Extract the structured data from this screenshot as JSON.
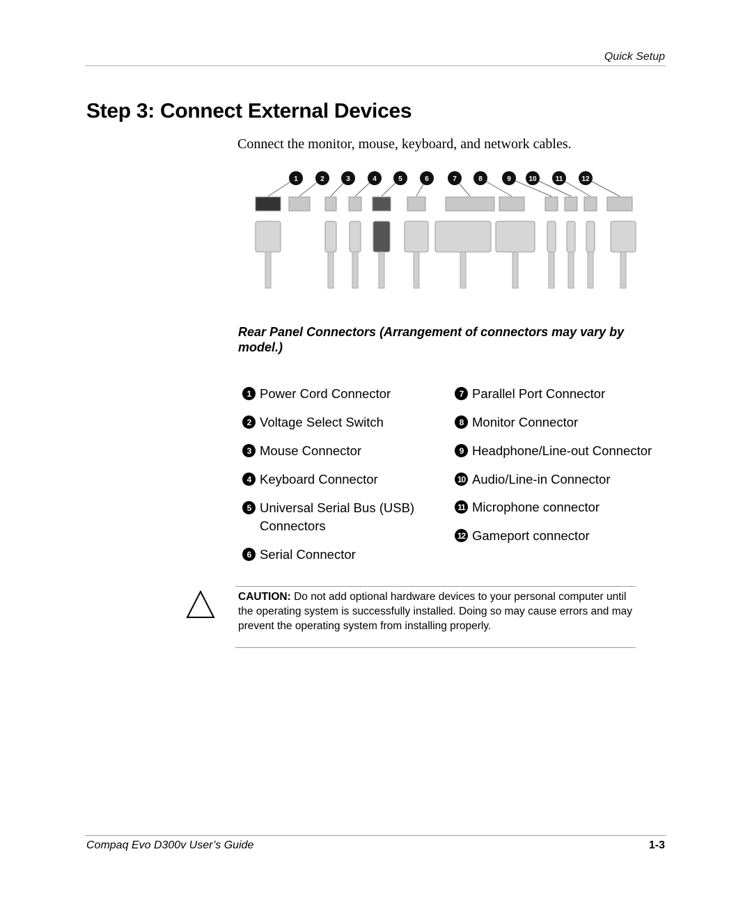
{
  "header": {
    "running_head": "Quick Setup"
  },
  "title": "Step 3: Connect External Devices",
  "intro": "Connect the monitor, mouse, keyboard, and network cables.",
  "figure": {
    "callout_numbers": [
      "1",
      "2",
      "3",
      "4",
      "5",
      "6",
      "7",
      "8",
      "9",
      "10",
      "11",
      "12"
    ]
  },
  "caption": "Rear Panel Connectors (Arrangement of connectors may vary by model.)",
  "legend": {
    "left": [
      {
        "num": "1",
        "label": "Power Cord Connector"
      },
      {
        "num": "2",
        "label": "Voltage Select Switch"
      },
      {
        "num": "3",
        "label": "Mouse Connector"
      },
      {
        "num": "4",
        "label": "Keyboard Connector"
      },
      {
        "num": "5",
        "label": "Universal Serial Bus (USB) Connectors"
      },
      {
        "num": "6",
        "label": "Serial Connector"
      }
    ],
    "right": [
      {
        "num": "7",
        "label": "Parallel Port Connector"
      },
      {
        "num": "8",
        "label": "Monitor Connector"
      },
      {
        "num": "9",
        "label": "Headphone/Line-out Connector"
      },
      {
        "num": "10",
        "label": "Audio/Line-in Connector"
      },
      {
        "num": "11",
        "label": "Microphone connector"
      },
      {
        "num": "12",
        "label": "Gameport connector"
      }
    ]
  },
  "caution": {
    "label": "CAUTION:",
    "text": " Do not add optional hardware devices to your personal computer until the operating system is successfully installed. Doing so may cause errors and may prevent the operating system from installing properly."
  },
  "footer": {
    "title": "Compaq Evo D300v User’s Guide",
    "page": "1-3"
  }
}
